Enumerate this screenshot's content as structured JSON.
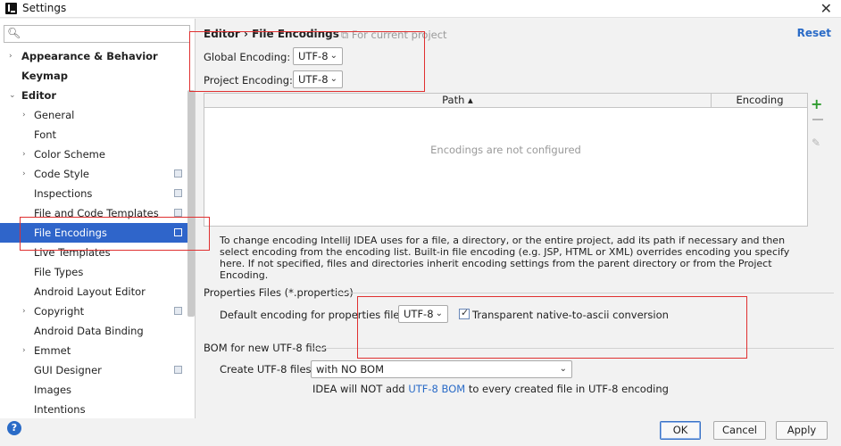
{
  "window": {
    "title": "Settings"
  },
  "sidebar": {
    "search_placeholder": "",
    "items": [
      {
        "label": "Appearance & Behavior",
        "arrow": "›",
        "bold": true,
        "indent": 0
      },
      {
        "label": "Keymap",
        "arrow": "",
        "bold": true,
        "indent": 0
      },
      {
        "label": "Editor",
        "arrow": "⌄",
        "bold": true,
        "indent": 0
      },
      {
        "label": "General",
        "arrow": "›",
        "bold": false,
        "indent": 1
      },
      {
        "label": "Font",
        "arrow": "",
        "bold": false,
        "indent": 1
      },
      {
        "label": "Color Scheme",
        "arrow": "›",
        "bold": false,
        "indent": 1
      },
      {
        "label": "Code Style",
        "arrow": "›",
        "bold": false,
        "indent": 1,
        "project": true
      },
      {
        "label": "Inspections",
        "arrow": "",
        "bold": false,
        "indent": 1,
        "project": true
      },
      {
        "label": "File and Code Templates",
        "arrow": "",
        "bold": false,
        "indent": 1,
        "project": true
      },
      {
        "label": "File Encodings",
        "arrow": "",
        "bold": false,
        "indent": 1,
        "project": true,
        "selected": true
      },
      {
        "label": "Live Templates",
        "arrow": "",
        "bold": false,
        "indent": 1
      },
      {
        "label": "File Types",
        "arrow": "",
        "bold": false,
        "indent": 1
      },
      {
        "label": "Android Layout Editor",
        "arrow": "",
        "bold": false,
        "indent": 1
      },
      {
        "label": "Copyright",
        "arrow": "›",
        "bold": false,
        "indent": 1,
        "project": true
      },
      {
        "label": "Android Data Binding",
        "arrow": "",
        "bold": false,
        "indent": 1
      },
      {
        "label": "Emmet",
        "arrow": "›",
        "bold": false,
        "indent": 1
      },
      {
        "label": "GUI Designer",
        "arrow": "",
        "bold": false,
        "indent": 1,
        "project": true
      },
      {
        "label": "Images",
        "arrow": "",
        "bold": false,
        "indent": 1
      },
      {
        "label": "Intentions",
        "arrow": "",
        "bold": false,
        "indent": 1
      }
    ]
  },
  "main": {
    "breadcrumb": "Editor  ›  File Encodings",
    "for_project": "For current project",
    "reset": "Reset",
    "global_label": "Global Encoding:",
    "global_value": "UTF-8",
    "project_label": "Project Encoding:",
    "project_value": "UTF-8",
    "table": {
      "col_path": "Path ▴",
      "col_encoding": "Encoding",
      "empty": "Encodings are not configured"
    },
    "info": "To change encoding IntelliJ IDEA uses for a file, a directory, or the entire project, add its path if necessary and then select encoding from the encoding list. Built-in file encoding (e.g. JSP, HTML or XML) overrides encoding you specify here. If not specified, files and directories inherit encoding settings from the parent directory or from the Project Encoding.",
    "properties_section": "Properties Files (*.properties)",
    "properties_label": "Default encoding for properties files:",
    "properties_value": "UTF-8",
    "native_ascii": "Transparent native-to-ascii conversion",
    "bom_section": "BOM for new UTF-8 files",
    "create_label": "Create UTF-8 files:",
    "create_value": "with NO BOM",
    "bom_note_pre": "IDEA will NOT add ",
    "bom_note_link": "UTF-8 BOM",
    "bom_note_post": " to every created file in UTF-8 encoding"
  },
  "buttons": {
    "ok": "OK",
    "cancel": "Cancel",
    "apply": "Apply",
    "help": "?"
  },
  "colors": {
    "selection": "#2f65ca",
    "link": "#2a6bc7",
    "highlight_box": "#e03030"
  }
}
